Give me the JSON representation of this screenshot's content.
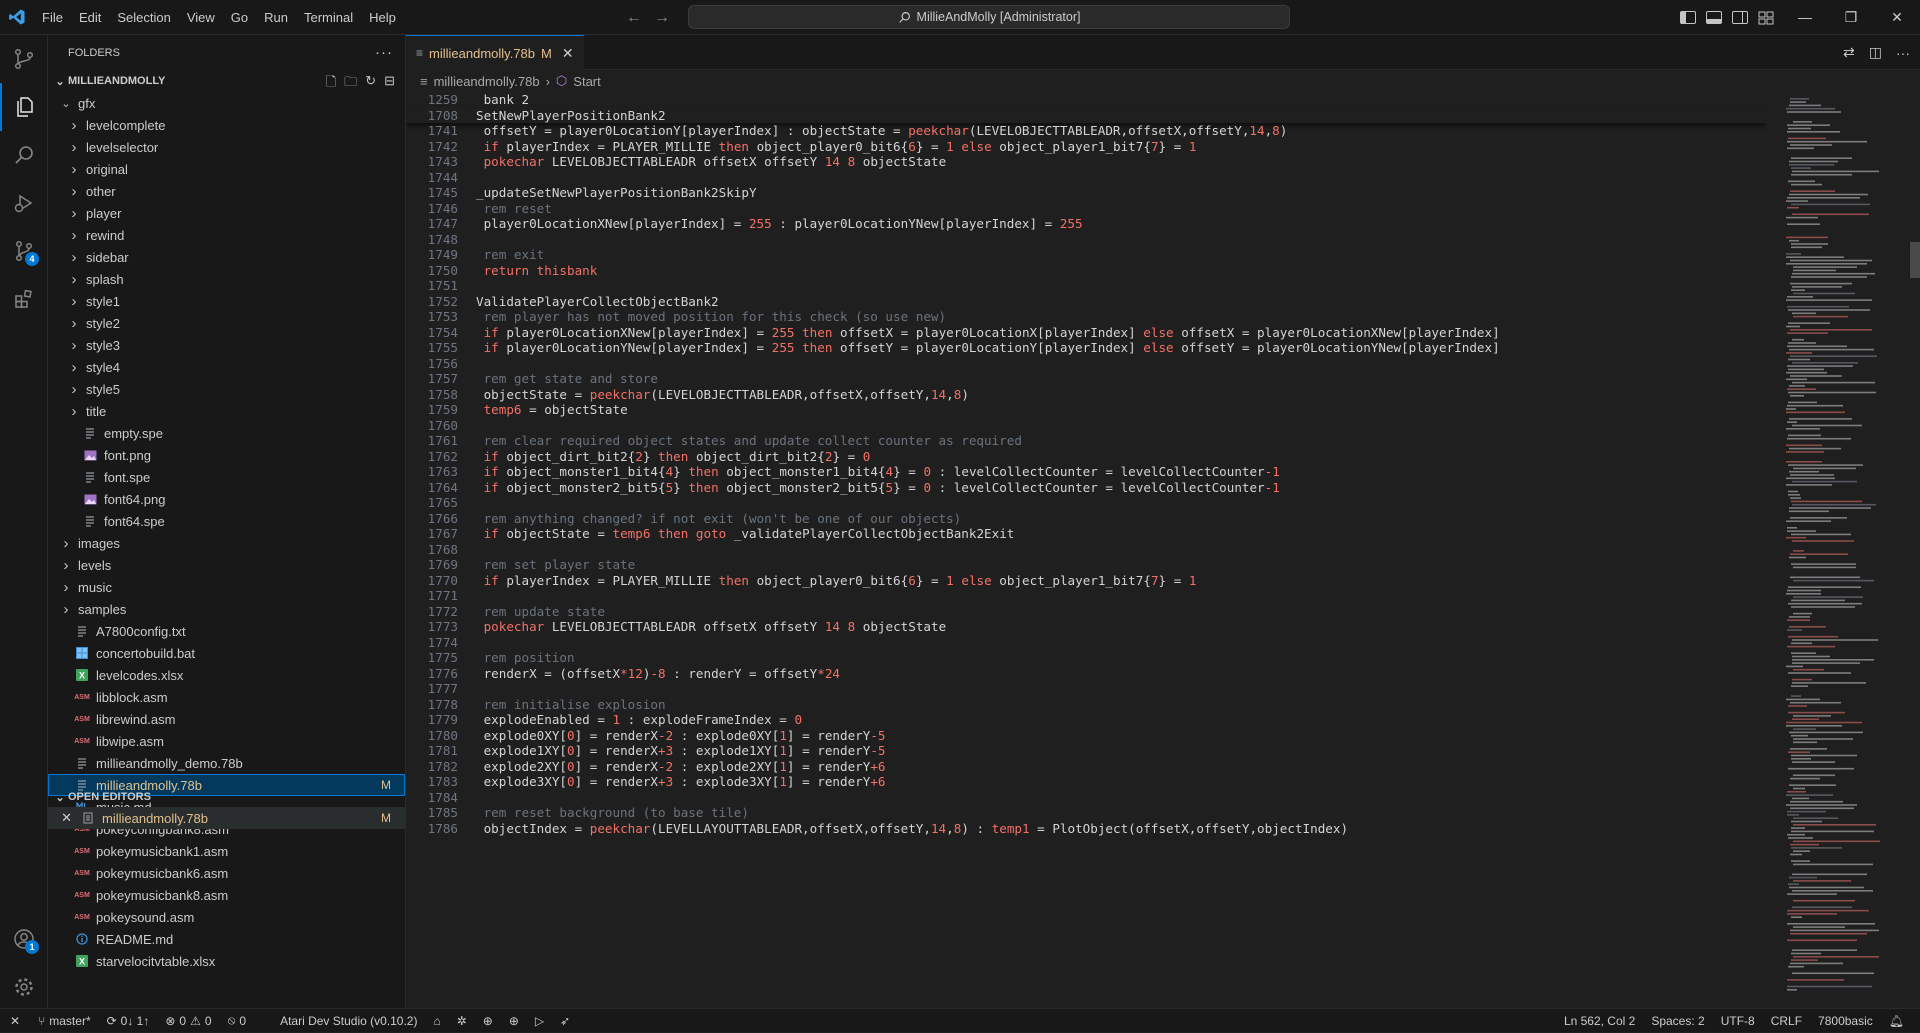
{
  "menu": [
    "File",
    "Edit",
    "Selection",
    "View",
    "Go",
    "Run",
    "Terminal",
    "Help"
  ],
  "command_center": "MillieAndMolly [Administrator]",
  "sidebar": {
    "title": "FOLDERS",
    "root": "MILLIEANDMOLLY",
    "tree": [
      {
        "label": "gfx",
        "type": "folder-open",
        "depth": 1
      },
      {
        "label": "levelcomplete",
        "type": "folder",
        "depth": 2
      },
      {
        "label": "levelselector",
        "type": "folder",
        "depth": 2
      },
      {
        "label": "original",
        "type": "folder",
        "depth": 2
      },
      {
        "label": "other",
        "type": "folder",
        "depth": 2
      },
      {
        "label": "player",
        "type": "folder",
        "depth": 2
      },
      {
        "label": "rewind",
        "type": "folder",
        "depth": 2
      },
      {
        "label": "sidebar",
        "type": "folder",
        "depth": 2
      },
      {
        "label": "splash",
        "type": "folder",
        "depth": 2
      },
      {
        "label": "style1",
        "type": "folder",
        "depth": 2
      },
      {
        "label": "style2",
        "type": "folder",
        "depth": 2
      },
      {
        "label": "style3",
        "type": "folder",
        "depth": 2
      },
      {
        "label": "style4",
        "type": "folder",
        "depth": 2
      },
      {
        "label": "style5",
        "type": "folder",
        "depth": 2
      },
      {
        "label": "title",
        "type": "folder",
        "depth": 2
      },
      {
        "label": "empty.spe",
        "type": "file-text",
        "depth": 2
      },
      {
        "label": "font.png",
        "type": "file-image",
        "depth": 2
      },
      {
        "label": "font.spe",
        "type": "file-text",
        "depth": 2
      },
      {
        "label": "font64.png",
        "type": "file-image",
        "depth": 2
      },
      {
        "label": "font64.spe",
        "type": "file-text",
        "depth": 2
      },
      {
        "label": "images",
        "type": "folder",
        "depth": 1
      },
      {
        "label": "levels",
        "type": "folder",
        "depth": 1
      },
      {
        "label": "music",
        "type": "folder",
        "depth": 1
      },
      {
        "label": "samples",
        "type": "folder",
        "depth": 1
      },
      {
        "label": "A7800config.txt",
        "type": "file-text",
        "depth": 1
      },
      {
        "label": "concertobuild.bat",
        "type": "file-bat",
        "depth": 1
      },
      {
        "label": "levelcodes.xlsx",
        "type": "file-xlsx",
        "depth": 1
      },
      {
        "label": "libblock.asm",
        "type": "file-asm",
        "depth": 1
      },
      {
        "label": "librewind.asm",
        "type": "file-asm",
        "depth": 1
      },
      {
        "label": "libwipe.asm",
        "type": "file-asm",
        "depth": 1
      },
      {
        "label": "millieandmolly_demo.78b",
        "type": "file-text",
        "depth": 1
      },
      {
        "label": "millieandmolly.78b",
        "type": "file-text",
        "depth": 1,
        "selected": true,
        "badge": "M"
      },
      {
        "label": "music.md",
        "type": "file-md",
        "depth": 1
      },
      {
        "label": "pokeyconfigbank8.asm",
        "type": "file-asm",
        "depth": 1
      },
      {
        "label": "pokeymusicbank1.asm",
        "type": "file-asm",
        "depth": 1
      },
      {
        "label": "pokeymusicbank6.asm",
        "type": "file-asm",
        "depth": 1
      },
      {
        "label": "pokeymusicbank8.asm",
        "type": "file-asm",
        "depth": 1
      },
      {
        "label": "pokeysound.asm",
        "type": "file-asm",
        "depth": 1
      },
      {
        "label": "README.md",
        "type": "file-info",
        "depth": 1
      },
      {
        "label": "starvelocitvtable.xlsx",
        "type": "file-xlsx",
        "depth": 1
      }
    ],
    "open_editors_title": "OPEN EDITORS",
    "open_editor": {
      "label": "millieandmolly.78b",
      "badge": "M"
    }
  },
  "tab": {
    "label": "millieandmolly.78b",
    "badge": "M"
  },
  "breadcrumb": {
    "file": "millieandmolly.78b",
    "symbol": "Start"
  },
  "code_lines": [
    {
      "n": "1259",
      "sticky": true,
      "t": [
        [
          "p",
          " bank 2"
        ]
      ]
    },
    {
      "n": "1708",
      "sticky": true,
      "t": [
        [
          "p",
          "SetNewPlayerPositionBank2"
        ]
      ]
    },
    {
      "n": "1741",
      "t": [
        [
          "p",
          " offsetY = player0LocationY[playerIndex] : objectState = "
        ],
        [
          "k",
          "peekchar"
        ],
        [
          "p",
          "(LEVELOBJECTTABLEADR,offsetX,offsetY,"
        ],
        [
          "n",
          "14"
        ],
        [
          "p",
          ","
        ],
        [
          "n",
          "8"
        ],
        [
          "p",
          ")"
        ]
      ]
    },
    {
      "n": "1742",
      "t": [
        [
          "p",
          " "
        ],
        [
          "k",
          "if"
        ],
        [
          "p",
          " playerIndex = PLAYER_MILLIE "
        ],
        [
          "k",
          "then"
        ],
        [
          "p",
          " object_player0_bit6{"
        ],
        [
          "n",
          "6"
        ],
        [
          "p",
          "} = "
        ],
        [
          "n",
          "1"
        ],
        [
          "p",
          " "
        ],
        [
          "k",
          "else"
        ],
        [
          "p",
          " object_player1_bit7{"
        ],
        [
          "n",
          "7"
        ],
        [
          "p",
          "} = "
        ],
        [
          "n",
          "1"
        ]
      ]
    },
    {
      "n": "1743",
      "t": [
        [
          "p",
          " "
        ],
        [
          "k",
          "pokechar"
        ],
        [
          "p",
          " LEVELOBJECTTABLEADR offsetX offsetY "
        ],
        [
          "n",
          "14"
        ],
        [
          "p",
          " "
        ],
        [
          "n",
          "8"
        ],
        [
          "p",
          " objectState"
        ]
      ]
    },
    {
      "n": "1744",
      "t": [
        [
          "p",
          ""
        ]
      ]
    },
    {
      "n": "1745",
      "t": [
        [
          "p",
          "_updateSetNewPlayerPositionBank2SkipY"
        ]
      ]
    },
    {
      "n": "1746",
      "t": [
        [
          "c",
          " rem reset"
        ]
      ]
    },
    {
      "n": "1747",
      "t": [
        [
          "p",
          " player0LocationXNew[playerIndex] = "
        ],
        [
          "n",
          "255"
        ],
        [
          "p",
          " : player0LocationYNew[playerIndex] = "
        ],
        [
          "n",
          "255"
        ]
      ]
    },
    {
      "n": "1748",
      "t": [
        [
          "p",
          ""
        ]
      ]
    },
    {
      "n": "1749",
      "t": [
        [
          "c",
          " rem exit"
        ]
      ]
    },
    {
      "n": "1750",
      "t": [
        [
          "p",
          " "
        ],
        [
          "k",
          "return thisbank"
        ]
      ]
    },
    {
      "n": "1751",
      "t": [
        [
          "p",
          ""
        ]
      ]
    },
    {
      "n": "1752",
      "t": [
        [
          "p",
          "ValidatePlayerCollectObjectBank2"
        ]
      ]
    },
    {
      "n": "1753",
      "t": [
        [
          "c",
          " rem player has not moved position for this check (so use new)"
        ]
      ]
    },
    {
      "n": "1754",
      "t": [
        [
          "p",
          " "
        ],
        [
          "k",
          "if"
        ],
        [
          "p",
          " player0LocationXNew[playerIndex] = "
        ],
        [
          "n",
          "255"
        ],
        [
          "p",
          " "
        ],
        [
          "k",
          "then"
        ],
        [
          "p",
          " offsetX = player0LocationX[playerIndex] "
        ],
        [
          "k",
          "else"
        ],
        [
          "p",
          " offsetX = player0LocationXNew[playerIndex]"
        ]
      ]
    },
    {
      "n": "1755",
      "t": [
        [
          "p",
          " "
        ],
        [
          "k",
          "if"
        ],
        [
          "p",
          " player0LocationYNew[playerIndex] = "
        ],
        [
          "n",
          "255"
        ],
        [
          "p",
          " "
        ],
        [
          "k",
          "then"
        ],
        [
          "p",
          " offsetY = player0LocationY[playerIndex] "
        ],
        [
          "k",
          "else"
        ],
        [
          "p",
          " offsetY = player0LocationYNew[playerIndex]"
        ]
      ]
    },
    {
      "n": "1756",
      "t": [
        [
          "p",
          ""
        ]
      ]
    },
    {
      "n": "1757",
      "t": [
        [
          "c",
          " rem get state and store"
        ]
      ]
    },
    {
      "n": "1758",
      "t": [
        [
          "p",
          " objectState = "
        ],
        [
          "k",
          "peekchar"
        ],
        [
          "p",
          "(LEVELOBJECTTABLEADR,offsetX,offsetY,"
        ],
        [
          "n",
          "14"
        ],
        [
          "p",
          ","
        ],
        [
          "n",
          "8"
        ],
        [
          "p",
          ")"
        ]
      ]
    },
    {
      "n": "1759",
      "t": [
        [
          "p",
          " "
        ],
        [
          "k",
          "temp6"
        ],
        [
          "p",
          " = objectState"
        ]
      ]
    },
    {
      "n": "1760",
      "t": [
        [
          "p",
          ""
        ]
      ]
    },
    {
      "n": "1761",
      "t": [
        [
          "c",
          " rem clear required object states and update collect counter as required"
        ]
      ]
    },
    {
      "n": "1762",
      "t": [
        [
          "p",
          " "
        ],
        [
          "k",
          "if"
        ],
        [
          "p",
          " object_dirt_bit2{"
        ],
        [
          "n",
          "2"
        ],
        [
          "p",
          "} "
        ],
        [
          "k",
          "then"
        ],
        [
          "p",
          " object_dirt_bit2{"
        ],
        [
          "n",
          "2"
        ],
        [
          "p",
          "} = "
        ],
        [
          "n",
          "0"
        ]
      ]
    },
    {
      "n": "1763",
      "t": [
        [
          "p",
          " "
        ],
        [
          "k",
          "if"
        ],
        [
          "p",
          " object_monster1_bit4{"
        ],
        [
          "n",
          "4"
        ],
        [
          "p",
          "} "
        ],
        [
          "k",
          "then"
        ],
        [
          "p",
          " object_monster1_bit4{"
        ],
        [
          "n",
          "4"
        ],
        [
          "p",
          "} = "
        ],
        [
          "n",
          "0"
        ],
        [
          "p",
          " : levelCollectCounter = levelCollectCounter"
        ],
        [
          "n",
          "-1"
        ]
      ]
    },
    {
      "n": "1764",
      "t": [
        [
          "p",
          " "
        ],
        [
          "k",
          "if"
        ],
        [
          "p",
          " object_monster2_bit5{"
        ],
        [
          "n",
          "5"
        ],
        [
          "p",
          "} "
        ],
        [
          "k",
          "then"
        ],
        [
          "p",
          " object_monster2_bit5{"
        ],
        [
          "n",
          "5"
        ],
        [
          "p",
          "} = "
        ],
        [
          "n",
          "0"
        ],
        [
          "p",
          " : levelCollectCounter = levelCollectCounter"
        ],
        [
          "n",
          "-1"
        ]
      ]
    },
    {
      "n": "1765",
      "t": [
        [
          "p",
          ""
        ]
      ]
    },
    {
      "n": "1766",
      "t": [
        [
          "c",
          " rem anything changed? if not exit (won't be one of our objects)"
        ]
      ]
    },
    {
      "n": "1767",
      "t": [
        [
          "p",
          " "
        ],
        [
          "k",
          "if"
        ],
        [
          "p",
          " objectState = "
        ],
        [
          "k",
          "temp6"
        ],
        [
          "p",
          " "
        ],
        [
          "k",
          "then goto"
        ],
        [
          "p",
          " _validatePlayerCollectObjectBank2Exit"
        ]
      ]
    },
    {
      "n": "1768",
      "t": [
        [
          "p",
          ""
        ]
      ]
    },
    {
      "n": "1769",
      "t": [
        [
          "c",
          " rem set player state"
        ]
      ]
    },
    {
      "n": "1770",
      "t": [
        [
          "p",
          " "
        ],
        [
          "k",
          "if"
        ],
        [
          "p",
          " playerIndex = PLAYER_MILLIE "
        ],
        [
          "k",
          "then"
        ],
        [
          "p",
          " object_player0_bit6{"
        ],
        [
          "n",
          "6"
        ],
        [
          "p",
          "} = "
        ],
        [
          "n",
          "1"
        ],
        [
          "p",
          " "
        ],
        [
          "k",
          "else"
        ],
        [
          "p",
          " object_player1_bit7{"
        ],
        [
          "n",
          "7"
        ],
        [
          "p",
          "} = "
        ],
        [
          "n",
          "1"
        ]
      ]
    },
    {
      "n": "1771",
      "t": [
        [
          "p",
          ""
        ]
      ]
    },
    {
      "n": "1772",
      "t": [
        [
          "c",
          " rem update state"
        ]
      ]
    },
    {
      "n": "1773",
      "t": [
        [
          "p",
          " "
        ],
        [
          "k",
          "pokechar"
        ],
        [
          "p",
          " LEVELOBJECTTABLEADR offsetX offsetY "
        ],
        [
          "n",
          "14"
        ],
        [
          "p",
          " "
        ],
        [
          "n",
          "8"
        ],
        [
          "p",
          " objectState"
        ]
      ]
    },
    {
      "n": "1774",
      "t": [
        [
          "p",
          ""
        ]
      ]
    },
    {
      "n": "1775",
      "t": [
        [
          "c",
          " rem position"
        ]
      ]
    },
    {
      "n": "1776",
      "t": [
        [
          "p",
          " renderX = (offsetX"
        ],
        [
          "n",
          "*12"
        ],
        [
          "p",
          ")"
        ],
        [
          "n",
          "-8"
        ],
        [
          "p",
          " : renderY = offsetY"
        ],
        [
          "n",
          "*24"
        ]
      ]
    },
    {
      "n": "1777",
      "t": [
        [
          "p",
          ""
        ]
      ]
    },
    {
      "n": "1778",
      "t": [
        [
          "c",
          " rem initialise explosion"
        ]
      ]
    },
    {
      "n": "1779",
      "t": [
        [
          "p",
          " explodeEnabled = "
        ],
        [
          "n",
          "1"
        ],
        [
          "p",
          " : explodeFrameIndex = "
        ],
        [
          "n",
          "0"
        ]
      ]
    },
    {
      "n": "1780",
      "t": [
        [
          "p",
          " explode0XY["
        ],
        [
          "n",
          "0"
        ],
        [
          "p",
          "] = renderX"
        ],
        [
          "n",
          "-2"
        ],
        [
          "p",
          " : explode0XY["
        ],
        [
          "n",
          "1"
        ],
        [
          "p",
          "] = renderY"
        ],
        [
          "n",
          "-5"
        ]
      ]
    },
    {
      "n": "1781",
      "t": [
        [
          "p",
          " explode1XY["
        ],
        [
          "n",
          "0"
        ],
        [
          "p",
          "] = renderX"
        ],
        [
          "n",
          "+3"
        ],
        [
          "p",
          " : explode1XY["
        ],
        [
          "n",
          "1"
        ],
        [
          "p",
          "] = renderY"
        ],
        [
          "n",
          "-5"
        ]
      ]
    },
    {
      "n": "1782",
      "t": [
        [
          "p",
          " explode2XY["
        ],
        [
          "n",
          "0"
        ],
        [
          "p",
          "] = renderX"
        ],
        [
          "n",
          "-2"
        ],
        [
          "p",
          " : explode2XY["
        ],
        [
          "n",
          "1"
        ],
        [
          "p",
          "] = renderY"
        ],
        [
          "n",
          "+6"
        ]
      ]
    },
    {
      "n": "1783",
      "t": [
        [
          "p",
          " explode3XY["
        ],
        [
          "n",
          "0"
        ],
        [
          "p",
          "] = renderX"
        ],
        [
          "n",
          "+3"
        ],
        [
          "p",
          " : explode3XY["
        ],
        [
          "n",
          "1"
        ],
        [
          "p",
          "] = renderY"
        ],
        [
          "n",
          "+6"
        ]
      ]
    },
    {
      "n": "1784",
      "t": [
        [
          "p",
          ""
        ]
      ]
    },
    {
      "n": "1785",
      "t": [
        [
          "c",
          " rem reset background (to base tile)"
        ]
      ]
    },
    {
      "n": "1786",
      "t": [
        [
          "p",
          " objectIndex = "
        ],
        [
          "k",
          "peekchar"
        ],
        [
          "p",
          "(LEVELLAYOUTTABLEADR,offsetX,offsetY,"
        ],
        [
          "n",
          "14"
        ],
        [
          "p",
          ","
        ],
        [
          "n",
          "8"
        ],
        [
          "p",
          ") : "
        ],
        [
          "k",
          "temp1"
        ],
        [
          "p",
          " = PlotObject(offsetX,offsetY,objectIndex)"
        ]
      ]
    }
  ],
  "status": {
    "branch": "master*",
    "sync": "0↓ 1↑",
    "errors": "0",
    "warnings": "0",
    "ports": "0",
    "extension": "Atari Dev Studio (v0.10.2)",
    "position": "Ln 562, Col 2",
    "spaces": "Spaces: 2",
    "encoding": "UTF-8",
    "eol": "CRLF",
    "language": "7800basic"
  },
  "badges": {
    "scm": "4",
    "accounts": "1"
  },
  "colors": {
    "accent": "#0078d4",
    "keyword": "#f47067",
    "comment": "#6a737d",
    "modified": "#e2c08d"
  }
}
